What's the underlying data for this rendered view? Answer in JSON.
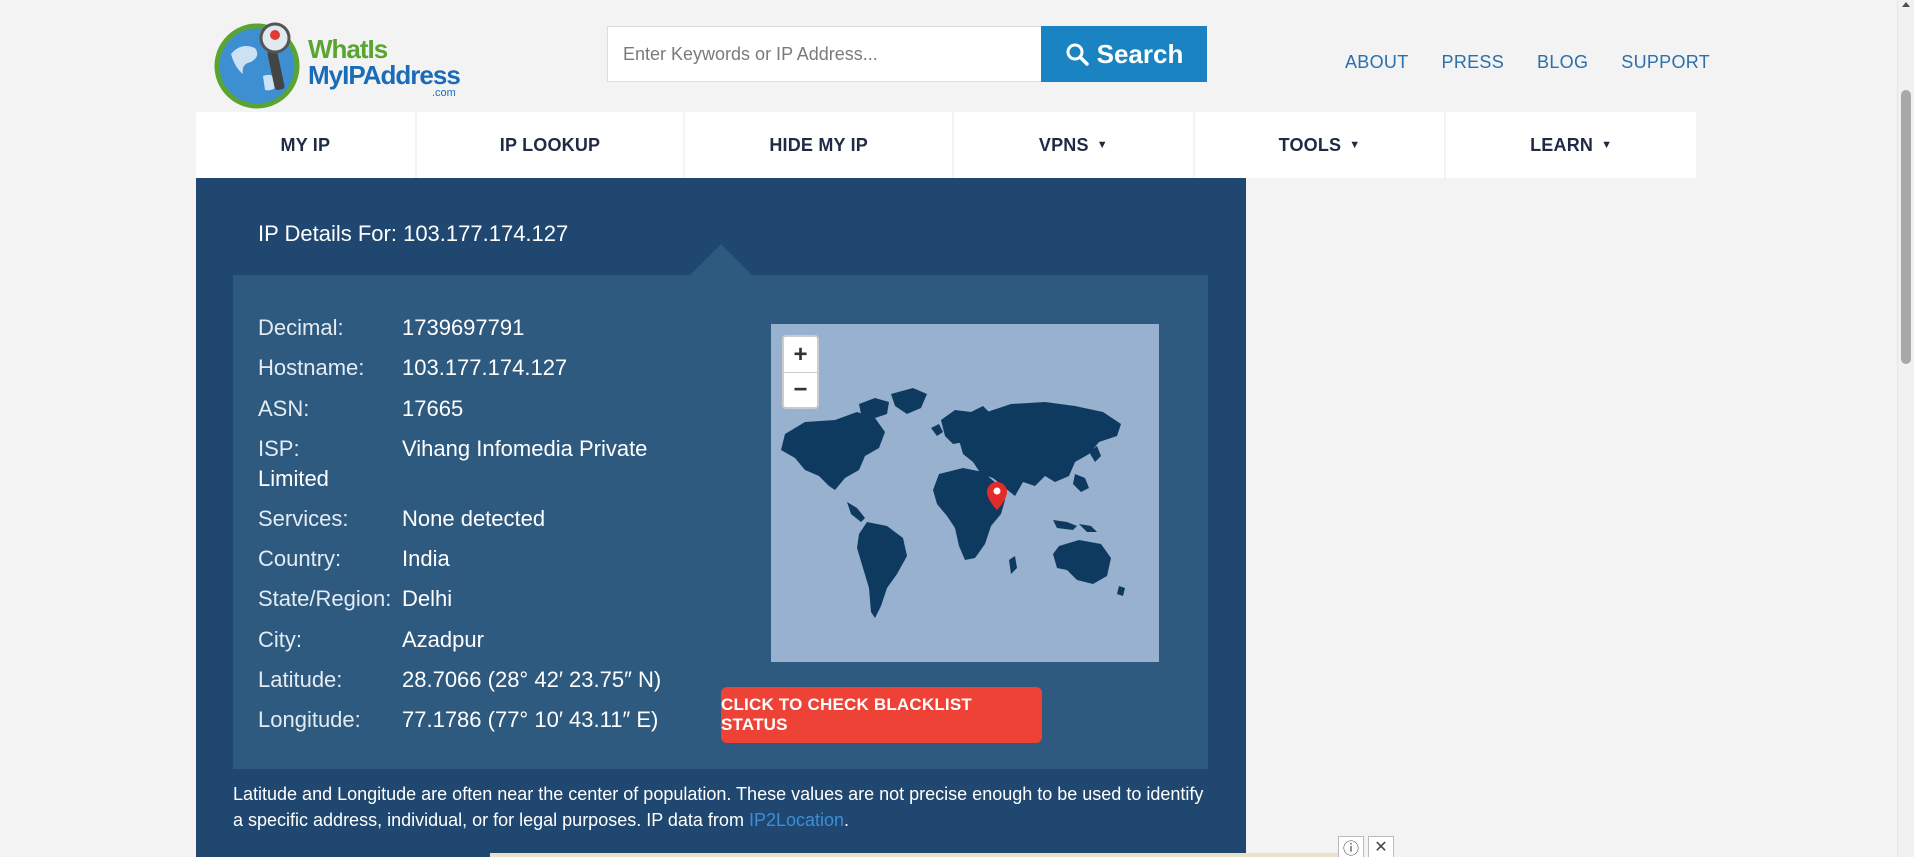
{
  "brand": {
    "line1": "WhatIs",
    "line2": "MyIPAddress",
    "line3": ".com"
  },
  "search": {
    "placeholder": "Enter Keywords or IP Address...",
    "button_label": "Search"
  },
  "top_links": [
    "ABOUT",
    "PRESS",
    "BLOG",
    "SUPPORT"
  ],
  "nav": [
    {
      "label": "MY IP",
      "dropdown": false
    },
    {
      "label": "IP LOOKUP",
      "dropdown": false
    },
    {
      "label": "HIDE MY IP",
      "dropdown": false
    },
    {
      "label": "VPNS",
      "dropdown": true
    },
    {
      "label": "TOOLS",
      "dropdown": true
    },
    {
      "label": "LEARN",
      "dropdown": true
    }
  ],
  "caret": "▼",
  "details": {
    "title": "IP Details For: 103.177.174.127",
    "decimal_label": "Decimal:",
    "decimal": "1739697791",
    "hostname_label": "Hostname:",
    "hostname": "103.177.174.127",
    "asn_label": "ASN:",
    "asn": "17665",
    "isp_label": "ISP:",
    "isp_line1": "Vihang Infomedia Private",
    "isp_line2": "Limited",
    "services_label": "Services:",
    "services": "None detected",
    "country_label": "Country:",
    "country": "India",
    "state_label": "State/Region:",
    "state": "Delhi",
    "city_label": "City:",
    "city": "Azadpur",
    "latitude_label": "Latitude:",
    "latitude": "28.7066 (28° 42′ 23.75″ N)",
    "longitude_label": "Longitude:",
    "longitude": "77.1786 (77° 10′ 43.11″ E)"
  },
  "map": {
    "zoom_in": "+",
    "zoom_out": "−"
  },
  "blacklist_button": "CLICK TO CHECK BLACKLIST STATUS",
  "note": {
    "text": "Latitude and Longitude are often near the center of population. These values are not precise enough to be used to identify a specific address, individual, or for legal purposes. IP data from ",
    "link": "IP2Location",
    "end": "."
  },
  "colors": {
    "panel": "#1f4770",
    "inner": "#2f5a80",
    "accent": "#1a83c2",
    "danger": "#ef4237",
    "map_water": "#97b1cf",
    "map_land": "#0e3a5f"
  },
  "icons": [
    "search-icon",
    "globe-logo-icon",
    "map-pin-icon",
    "adchoices-icon",
    "close-icon"
  ]
}
